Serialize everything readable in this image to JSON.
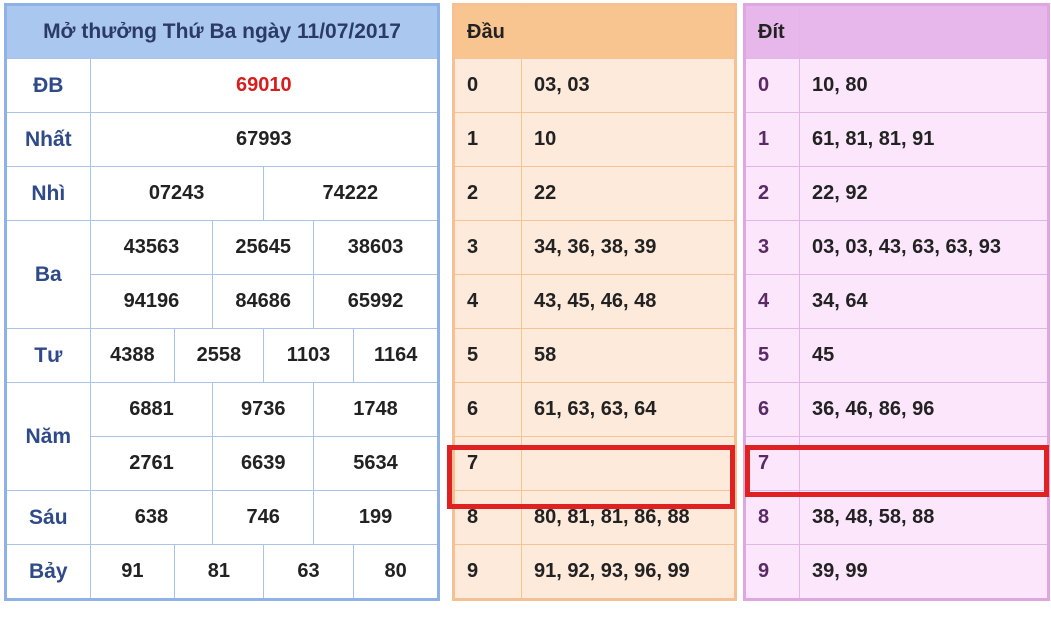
{
  "results": {
    "title": "Mở thưởng Thứ Ba ngày 11/07/2017",
    "dac_biet": {
      "label": "ĐB",
      "numbers": [
        "69010"
      ]
    },
    "nhat": {
      "label": "Nhất",
      "numbers": [
        "67993"
      ]
    },
    "nhi": {
      "label": "Nhì",
      "numbers": [
        "07243",
        "74222"
      ]
    },
    "ba": {
      "label": "Ba",
      "numbers": [
        "43563",
        "25645",
        "38603",
        "94196",
        "84686",
        "65992"
      ]
    },
    "tu": {
      "label": "Tư",
      "numbers": [
        "4388",
        "2558",
        "1103",
        "1164"
      ]
    },
    "nam": {
      "label": "Năm",
      "numbers": [
        "6881",
        "9736",
        "1748",
        "2761",
        "6639",
        "5634"
      ]
    },
    "sau": {
      "label": "Sáu",
      "numbers": [
        "638",
        "746",
        "199"
      ]
    },
    "bay": {
      "label": "Bảy",
      "numbers": [
        "91",
        "81",
        "63",
        "80"
      ]
    }
  },
  "dau": {
    "header": "Đầu",
    "rows": [
      {
        "digit": "0",
        "values": "03, 03"
      },
      {
        "digit": "1",
        "values": "10"
      },
      {
        "digit": "2",
        "values": "22"
      },
      {
        "digit": "3",
        "values": "34, 36, 38, 39"
      },
      {
        "digit": "4",
        "values": "43, 45, 46, 48"
      },
      {
        "digit": "5",
        "values": "58"
      },
      {
        "digit": "6",
        "values": "61, 63, 63, 64"
      },
      {
        "digit": "7",
        "values": ""
      },
      {
        "digit": "8",
        "values": "80, 81, 81, 86, 88"
      },
      {
        "digit": "9",
        "values": "91, 92, 93, 96, 99"
      }
    ]
  },
  "dit": {
    "header": "Đít",
    "rows": [
      {
        "digit": "0",
        "values": "10, 80"
      },
      {
        "digit": "1",
        "values": "61, 81, 81, 91"
      },
      {
        "digit": "2",
        "values": "22, 92"
      },
      {
        "digit": "3",
        "values": "03, 03, 43, 63, 63, 93"
      },
      {
        "digit": "4",
        "values": "34, 64"
      },
      {
        "digit": "5",
        "values": "45"
      },
      {
        "digit": "6",
        "values": "36, 46, 86, 96"
      },
      {
        "digit": "7",
        "values": ""
      },
      {
        "digit": "8",
        "values": "38, 48, 58, 88"
      },
      {
        "digit": "9",
        "values": "39, 99"
      }
    ]
  },
  "colors": {
    "special_number": "#d71e1e",
    "highlight_box": "#e02121",
    "main_header": "#aac8ef",
    "dau_header": "#f8c590",
    "dit_header": "#e7b6ea"
  }
}
